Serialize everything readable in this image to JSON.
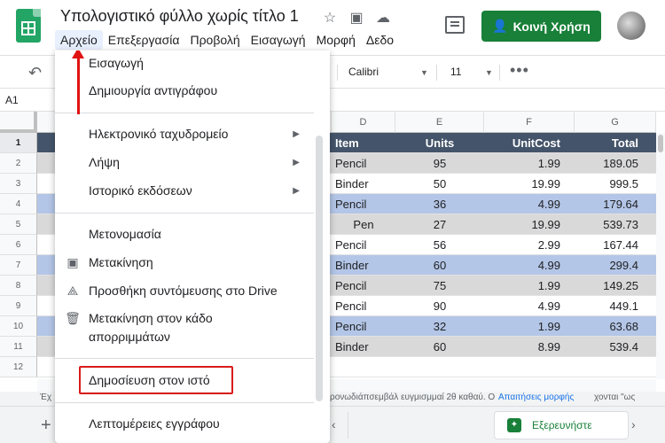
{
  "app": {
    "title": "Υπολογιστικό φύλλο χωρίς τίτλο 1",
    "title_icons": [
      "star-icon",
      "folder-move-icon",
      "cloud-status-icon"
    ]
  },
  "menubar": {
    "items": [
      "Αρχείο",
      "Επεξεργασία",
      "Προβολή",
      "Εισαγωγή",
      "Μορφή",
      "Δεδο"
    ]
  },
  "header": {
    "share_label": "Κοινή Χρήση",
    "share_color": "#188038"
  },
  "toolbar": {
    "font": "Calibri",
    "size": "11",
    "more": "•••"
  },
  "formula_bar": {
    "cell_ref": "A1"
  },
  "grid": {
    "columns": [
      "D",
      "E",
      "F",
      "G"
    ],
    "row_numbers": [
      "1",
      "2",
      "3",
      "4",
      "5",
      "6",
      "7",
      "8",
      "9",
      "10",
      "11",
      "12"
    ],
    "header_row": [
      "Item",
      "Units",
      "UnitCost",
      "Total"
    ],
    "header_color": "#44546a",
    "band_color_gray": "#d9d9d9",
    "band_color_blue": "#b4c6e7",
    "rows": [
      [
        "Pencil",
        "95",
        "1.99",
        "189.05"
      ],
      [
        "Binder",
        "50",
        "19.99",
        "999.5"
      ],
      [
        "Pencil",
        "36",
        "4.99",
        "179.64"
      ],
      [
        "Pen",
        "27",
        "19.99",
        "539.73"
      ],
      [
        "Pencil",
        "56",
        "2.99",
        "167.44"
      ],
      [
        "Binder",
        "60",
        "4.99",
        "299.4"
      ],
      [
        "Pencil",
        "75",
        "1.99",
        "149.25"
      ],
      [
        "Pencil",
        "90",
        "4.99",
        "449.1"
      ],
      [
        "Pencil",
        "32",
        "1.99",
        "63.68"
      ],
      [
        "Binder",
        "60",
        "8.99",
        "539.4"
      ]
    ]
  },
  "file_menu": {
    "items": [
      {
        "label": "Εισαγωγή"
      },
      {
        "label": "Δημιουργία αντιγράφου"
      },
      {
        "label": "Ηλεκτρονικό ταχυδρομείο",
        "submenu": true
      },
      {
        "label": "Λήψη",
        "submenu": true
      },
      {
        "label": "Ιστορικό εκδόσεων",
        "submenu": true
      },
      {
        "label": "Μετονομασία"
      },
      {
        "label": "Μετακίνηση",
        "icon": "folder-move-icon"
      },
      {
        "label": "Προσθήκη συντόμευσης στο Drive",
        "icon": "drive-shortcut-icon"
      },
      {
        "label": "Μετακίνηση στον κάδο απορριμμάτων",
        "icon": "trash-icon"
      },
      {
        "label": "Δημοσίευση στον ιστό"
      },
      {
        "label": "Λεπτομέρειες εγγράφου"
      }
    ]
  },
  "bottom": {
    "text1": "Έχ",
    "text2": "ρονωδιάπσεμβάλ ευγμισμμαί 2θ καθαύ. Ο",
    "link": "Απαιτήσεις μορφής",
    "text3": "χονται \"ως",
    "explore_label": "Εξερευνήστε"
  },
  "annotations": {
    "highlight_color": "#d81b1b",
    "arrow_color": "#e01212"
  }
}
